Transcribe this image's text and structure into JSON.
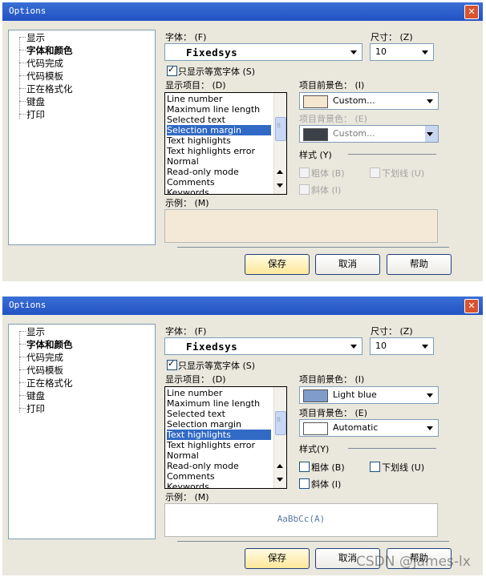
{
  "watermark": "CSDN @james-lx",
  "dialogs": [
    {
      "title": "Options",
      "close": "✕",
      "tree": [
        "显示",
        "字体和颜色",
        "代码完成",
        "代码模板",
        "正在格式化",
        "键盘",
        "打印"
      ],
      "font_label": "字体： (F)",
      "font_value": "Fixedsys",
      "size_label": "尺寸： (Z)",
      "size_value": "10",
      "monospace_only": "只显示等宽字体 (S)",
      "display_items_label": "显示项目： (D)",
      "display_items": [
        "Line number",
        "Maximum line length",
        "Selected text",
        "Selection margin",
        "Text highlights",
        "Text highlights error",
        "Normal",
        "Read-only mode",
        "Comments",
        "Keywords"
      ],
      "selected_item": "Selection margin",
      "fg_label": "项目前景色： (I)",
      "fg_value": "Custom...",
      "fg_color": "#f5e7cf",
      "bg_label": "项目背景色： (E)",
      "bg_value": "Custom...",
      "bg_color": "#3b4146",
      "style_label": "样式 (Y)",
      "bold_label": "粗体 (B)",
      "italic_label": "斜体 (I)",
      "underline_label": "下划线 (U)",
      "example_label": "示例： (M)",
      "preview_text": "",
      "preview_bg": "#f3e9d6",
      "buttons": {
        "save": "保存",
        "cancel": "取消",
        "help": "帮助"
      }
    },
    {
      "title": "Options",
      "close": "✕",
      "tree": [
        "显示",
        "字体和颜色",
        "代码完成",
        "代码模板",
        "正在格式化",
        "键盘",
        "打印"
      ],
      "font_label": "字体： (F)",
      "font_value": "Fixedsys",
      "size_label": "尺寸： (Z)",
      "size_value": "10",
      "monospace_only": "只显示等宽字体 (S)",
      "display_items_label": "显示项目： (D)",
      "display_items": [
        "Line number",
        "Maximum line length",
        "Selected text",
        "Selection margin",
        "Text highlights",
        "Text highlights error",
        "Normal",
        "Read-only mode",
        "Comments",
        "Keywords"
      ],
      "selected_item": "Text highlights",
      "fg_label": "项目前景色： (I)",
      "fg_value": "Light blue",
      "fg_color": "#7f9ccb",
      "bg_label": "项目背景色： (E)",
      "bg_value": "Automatic",
      "bg_color": "#ffffff",
      "style_label": "样式(Y)",
      "bold_label": "粗体 (B)",
      "italic_label": "斜体 (I)",
      "underline_label": "下划线 (U)",
      "example_label": "示例： (M)",
      "preview_text": "AaBbCc(A)",
      "preview_bg": "#ffffff",
      "buttons": {
        "save": "保存",
        "cancel": "取消",
        "help": "帮助"
      }
    }
  ]
}
